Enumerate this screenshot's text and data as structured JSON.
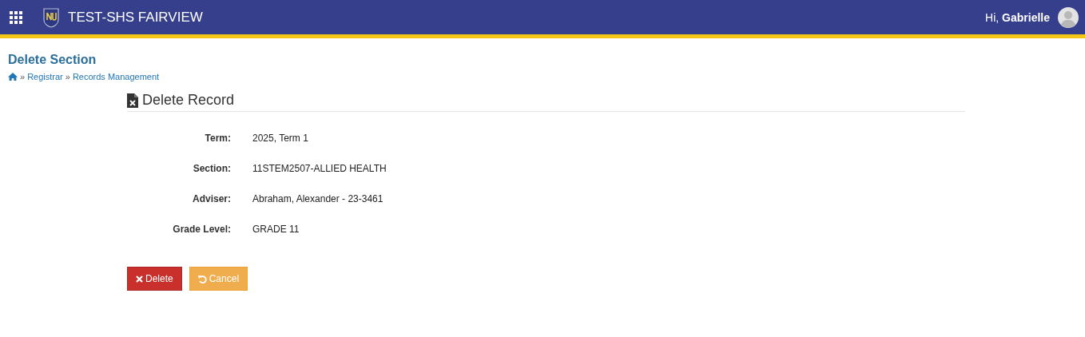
{
  "header": {
    "app_title": "TEST-SHS FAIRVIEW",
    "greeting": "Hi, **Gabrielle**"
  },
  "page": {
    "title": "Delete Section",
    "breadcrumb": [
      {
        "kind": "home"
      },
      {
        "kind": "separator",
        "text": "»"
      },
      {
        "kind": "link",
        "text": "Registrar"
      },
      {
        "kind": "separator",
        "text": "»"
      },
      {
        "kind": "link",
        "text": "Records Management"
      }
    ]
  },
  "panel": {
    "heading": "Delete Record",
    "fields": [
      {
        "label": "Term:",
        "value": "2025, Term 1"
      },
      {
        "label": "Section:",
        "value": "11STEM2507-ALLIED HEALTH"
      },
      {
        "label": "Adviser:",
        "value": "Abraham, Alexander - 23-3461"
      },
      {
        "label": "Grade Level:",
        "value": "GRADE 11"
      }
    ],
    "buttons": [
      {
        "kind": "delete",
        "label": "Delete"
      },
      {
        "kind": "cancel",
        "label": "Cancel"
      }
    ]
  }
}
